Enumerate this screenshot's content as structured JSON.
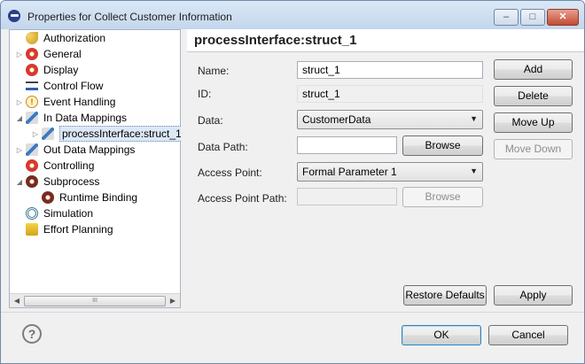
{
  "window": {
    "title": "Properties for Collect Customer Information",
    "minimize_glyph": "–",
    "maximize_glyph": "□",
    "close_glyph": "✕"
  },
  "tree": {
    "items": [
      {
        "label": "Authorization",
        "icon": "key-icon",
        "expander": ""
      },
      {
        "label": "General",
        "icon": "gear-icon",
        "expander": "▷"
      },
      {
        "label": "Display",
        "icon": "gear-icon",
        "expander": ""
      },
      {
        "label": "Control Flow",
        "icon": "control-flow-icon",
        "expander": ""
      },
      {
        "label": "Event Handling",
        "icon": "warning-icon",
        "expander": "▷"
      },
      {
        "label": "In Data Mappings",
        "icon": "data-mapping-icon",
        "expander": "◢"
      },
      {
        "label": "processInterface:struct_1",
        "icon": "data-mapping-icon",
        "expander": "▷"
      },
      {
        "label": "Out Data Mappings",
        "icon": "data-mapping-icon",
        "expander": "▷"
      },
      {
        "label": "Controlling",
        "icon": "gear-icon",
        "expander": ""
      },
      {
        "label": "Subprocess",
        "icon": "gear-icon",
        "expander": "◢"
      },
      {
        "label": "Runtime Binding",
        "icon": "gear-icon",
        "expander": ""
      },
      {
        "label": "Simulation",
        "icon": "simulation-icon",
        "expander": ""
      },
      {
        "label": "Effort Planning",
        "icon": "effort-icon",
        "expander": ""
      }
    ],
    "selected": "processInterface:struct_1",
    "scroll_left": "◀",
    "scroll_right": "▶",
    "scroll_thumb": "III"
  },
  "page": {
    "title": "processInterface:struct_1",
    "name_label": "Name:",
    "name_value": "struct_1",
    "id_label": "ID:",
    "id_value": "struct_1",
    "data_label": "Data:",
    "data_value": "CustomerData",
    "data_path_label": "Data Path:",
    "data_path_value": "",
    "access_point_label": "Access Point:",
    "access_point_value": "Formal Parameter 1",
    "access_point_path_label": "Access Point Path:",
    "access_point_path_value": "",
    "browse_label": "Browse",
    "dropdown_caret": "▼"
  },
  "side_buttons": {
    "add": "Add",
    "delete": "Delete",
    "move_up": "Move Up",
    "move_down": "Move Down"
  },
  "page_buttons": {
    "restore_defaults": "Restore Defaults",
    "apply": "Apply"
  },
  "dialog_buttons": {
    "help": "?",
    "ok": "OK",
    "cancel": "Cancel"
  }
}
